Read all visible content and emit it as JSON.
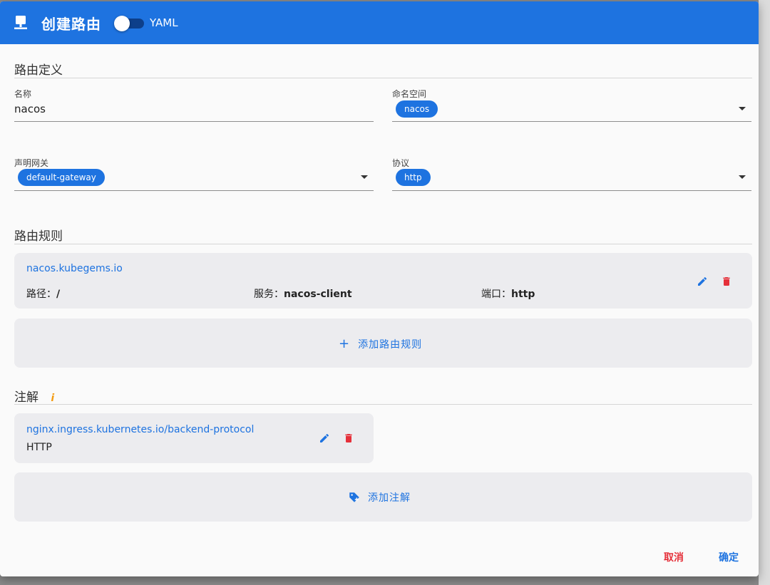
{
  "header": {
    "title": "创建路由",
    "yaml_label": "YAML"
  },
  "route_definition": {
    "section_title": "路由定义",
    "name_label": "名称",
    "name_value": "nacos",
    "namespace_label": "命名空间",
    "namespace_value": "nacos",
    "gateway_label": "声明网关",
    "gateway_value": "default-gateway",
    "protocol_label": "协议",
    "protocol_value": "http"
  },
  "route_rules": {
    "section_title": "路由规则",
    "rules": [
      {
        "host": "nacos.kubegems.io",
        "path_label": "路径：",
        "path_value": "/",
        "service_label": "服务：",
        "service_value": "nacos-client",
        "port_label": "端口：",
        "port_value": "http"
      }
    ],
    "add_label": "添加路由规则",
    "add_icon": "plus-icon",
    "edit_icon": "pencil-icon",
    "delete_icon": "trash-icon"
  },
  "annotations": {
    "section_title": "注解",
    "info_glyph": "i",
    "items": [
      {
        "key": "nginx.ingress.kubernetes.io/backend-protocol",
        "value": "HTTP"
      }
    ],
    "add_label": "添加注解",
    "add_icon": "tag-plus-icon"
  },
  "footer": {
    "cancel_label": "取消",
    "confirm_label": "确定"
  },
  "colors": {
    "primary": "#1e73e0",
    "danger": "#e5303a",
    "info": "#f39c12"
  }
}
